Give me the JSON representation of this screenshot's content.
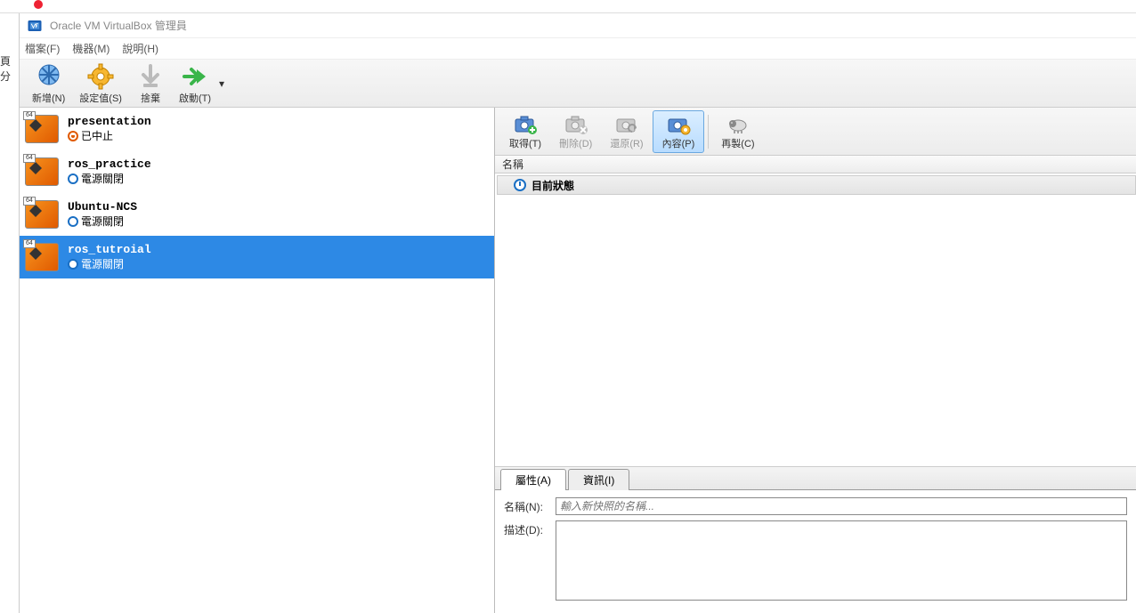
{
  "outer": {
    "left_text": "頁 分"
  },
  "window": {
    "title": "Oracle VM VirtualBox 管理員"
  },
  "menubar": {
    "file": "檔案(F)",
    "machine": "機器(M)",
    "help": "說明(H)"
  },
  "toolbar": {
    "new": "新增(N)",
    "settings": "設定值(S)",
    "discard": "捨棄",
    "start": "啟動(T)"
  },
  "vm_list": [
    {
      "name": "presentation",
      "status": "已中止",
      "state_color": "#e05a00",
      "state_icon": "aborted"
    },
    {
      "name": "ros_practice",
      "status": "電源關閉",
      "state_color": "#1a6fc4",
      "state_icon": "off"
    },
    {
      "name": "Ubuntu-NCS",
      "status": "電源關閉",
      "state_color": "#1a6fc4",
      "state_icon": "off"
    },
    {
      "name": "ros_tutroial",
      "status": "電源關閉",
      "state_color": "#1a6fc4",
      "state_icon": "off",
      "selected": true
    }
  ],
  "snapshot_toolbar": {
    "take": "取得(T)",
    "delete": "刪除(D)",
    "restore": "還原(R)",
    "properties": "內容(P)",
    "clone": "再製(C)"
  },
  "snapshot": {
    "col_header": "名稱",
    "current_state": "目前狀態"
  },
  "tabs": {
    "attributes": "屬性(A)",
    "info": "資訊(I)"
  },
  "form": {
    "name_label": "名稱(N):",
    "name_placeholder": "輸入新快照的名稱...",
    "desc_label": "描述(D):"
  },
  "badge64": "64"
}
